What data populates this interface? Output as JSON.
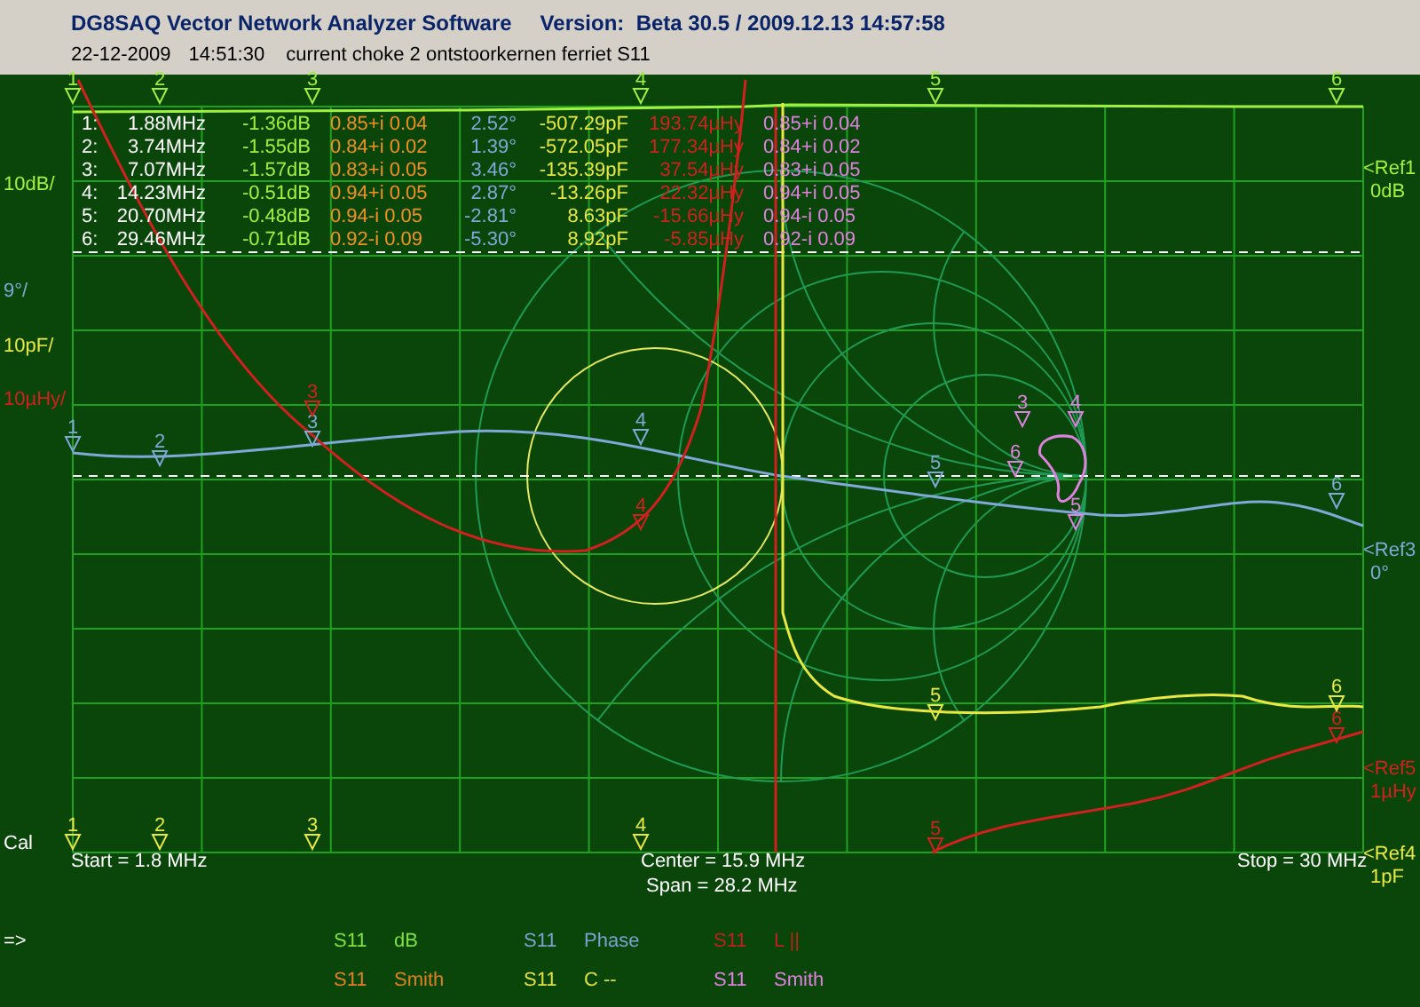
{
  "window": {
    "title": "DG8SAQ Vector Network Analyzer Software",
    "version": "Version:  Beta 30.5 / 2009.12.13 14:57:58"
  },
  "header": {
    "date": "22-12-2009",
    "time": "14:51:30",
    "description": "current choke 2 ontstoorkernen ferriet S11"
  },
  "scale_labels": [
    {
      "text": "10dB/",
      "color": "#a0f040"
    },
    {
      "text": "9°/",
      "color": "#80a8d8"
    },
    {
      "text": "10pF/",
      "color": "#e8e840"
    },
    {
      "text": "10µHy/",
      "color": "#d02020"
    }
  ],
  "ref_labels": [
    {
      "ref": "<Ref1",
      "value": "0dB",
      "color": "#a0f040"
    },
    {
      "ref": "<Ref3",
      "value": "0°",
      "color": "#80a8d8"
    },
    {
      "ref": "<Ref5",
      "value": "1µHy",
      "color": "#d02020"
    },
    {
      "ref": "<Ref4",
      "value": "1pF",
      "color": "#e8e840"
    }
  ],
  "traces": [
    {
      "kind": "db",
      "color": "#a0f040",
      "markers": [
        "1",
        "2",
        "3",
        "4",
        "5",
        "6"
      ]
    },
    {
      "kind": "phase",
      "color": "#80a8d8",
      "markers": [
        "1",
        "2",
        "3",
        "4",
        "5",
        "6"
      ]
    },
    {
      "kind": "inductance",
      "color": "#d02020",
      "markers": [
        "3",
        "4",
        "5",
        "6"
      ]
    },
    {
      "kind": "capacitance",
      "color": "#e8e840",
      "markers": [
        "1",
        "2",
        "3",
        "4",
        "5",
        "6"
      ]
    },
    {
      "kind": "smith",
      "color": "#e080e0",
      "markers": [
        "3",
        "4",
        "6",
        "5"
      ]
    }
  ],
  "marker_table": {
    "columns": [
      {
        "color": "#ffffff"
      },
      {
        "color": "#ffffff"
      },
      {
        "color": "#a0f040"
      },
      {
        "color": "#f09020"
      },
      {
        "color": "#80a8d8"
      },
      {
        "color": "#e8e840"
      },
      {
        "color": "#d02020"
      },
      {
        "color": "#e080e0"
      }
    ],
    "rows": [
      [
        "1:",
        "1.88MHz",
        "-1.36dB",
        "0.85+i 0.04",
        "2.52°",
        "-507.29pF",
        "193.74µHy",
        "0.85+i 0.04"
      ],
      [
        "2:",
        "3.74MHz",
        "-1.55dB",
        "0.84+i 0.02",
        "1.39°",
        "-572.05pF",
        "177.34µHy",
        "0.84+i 0.02"
      ],
      [
        "3:",
        "7.07MHz",
        "-1.57dB",
        "0.83+i 0.05",
        "3.46°",
        "-135.39pF",
        "37.54µHy",
        "0.83+i 0.05"
      ],
      [
        "4:",
        "14.23MHz",
        "-0.51dB",
        "0.94+i 0.05",
        "2.87°",
        "-13.26pF",
        "22.32µHy",
        "0.94+i 0.05"
      ],
      [
        "5:",
        "20.70MHz",
        "-0.48dB",
        "0.94-i 0.05",
        "-2.81°",
        "8.63pF",
        "-15.66µHy",
        "0.94-i 0.05"
      ],
      [
        "6:",
        "29.46MHz",
        "-0.71dB",
        "0.92-i 0.09",
        "-5.30°",
        "8.92pF",
        "-5.85µHy",
        "0.92-i 0.09"
      ]
    ]
  },
  "cal_label": "Cal",
  "sweep": {
    "start": "Start = 1.8 MHz",
    "center": "Center = 15.9 MHz",
    "span": "Span = 28.2 MHz",
    "stop": "Stop = 30 MHz"
  },
  "prompt": "=>",
  "legend": [
    {
      "param": "S11",
      "format": "dB",
      "color": "#80e040"
    },
    {
      "param": "S11",
      "format": "Phase",
      "color": "#80a0d0"
    },
    {
      "param": "S11",
      "format": "L ||",
      "color": "#c02020"
    },
    {
      "param": "S11",
      "format": "Smith",
      "color": "#e08020"
    },
    {
      "param": "S11",
      "format": "C --",
      "color": "#e0e040"
    },
    {
      "param": "S11",
      "format": "Smith",
      "color": "#e080e0"
    }
  ]
}
